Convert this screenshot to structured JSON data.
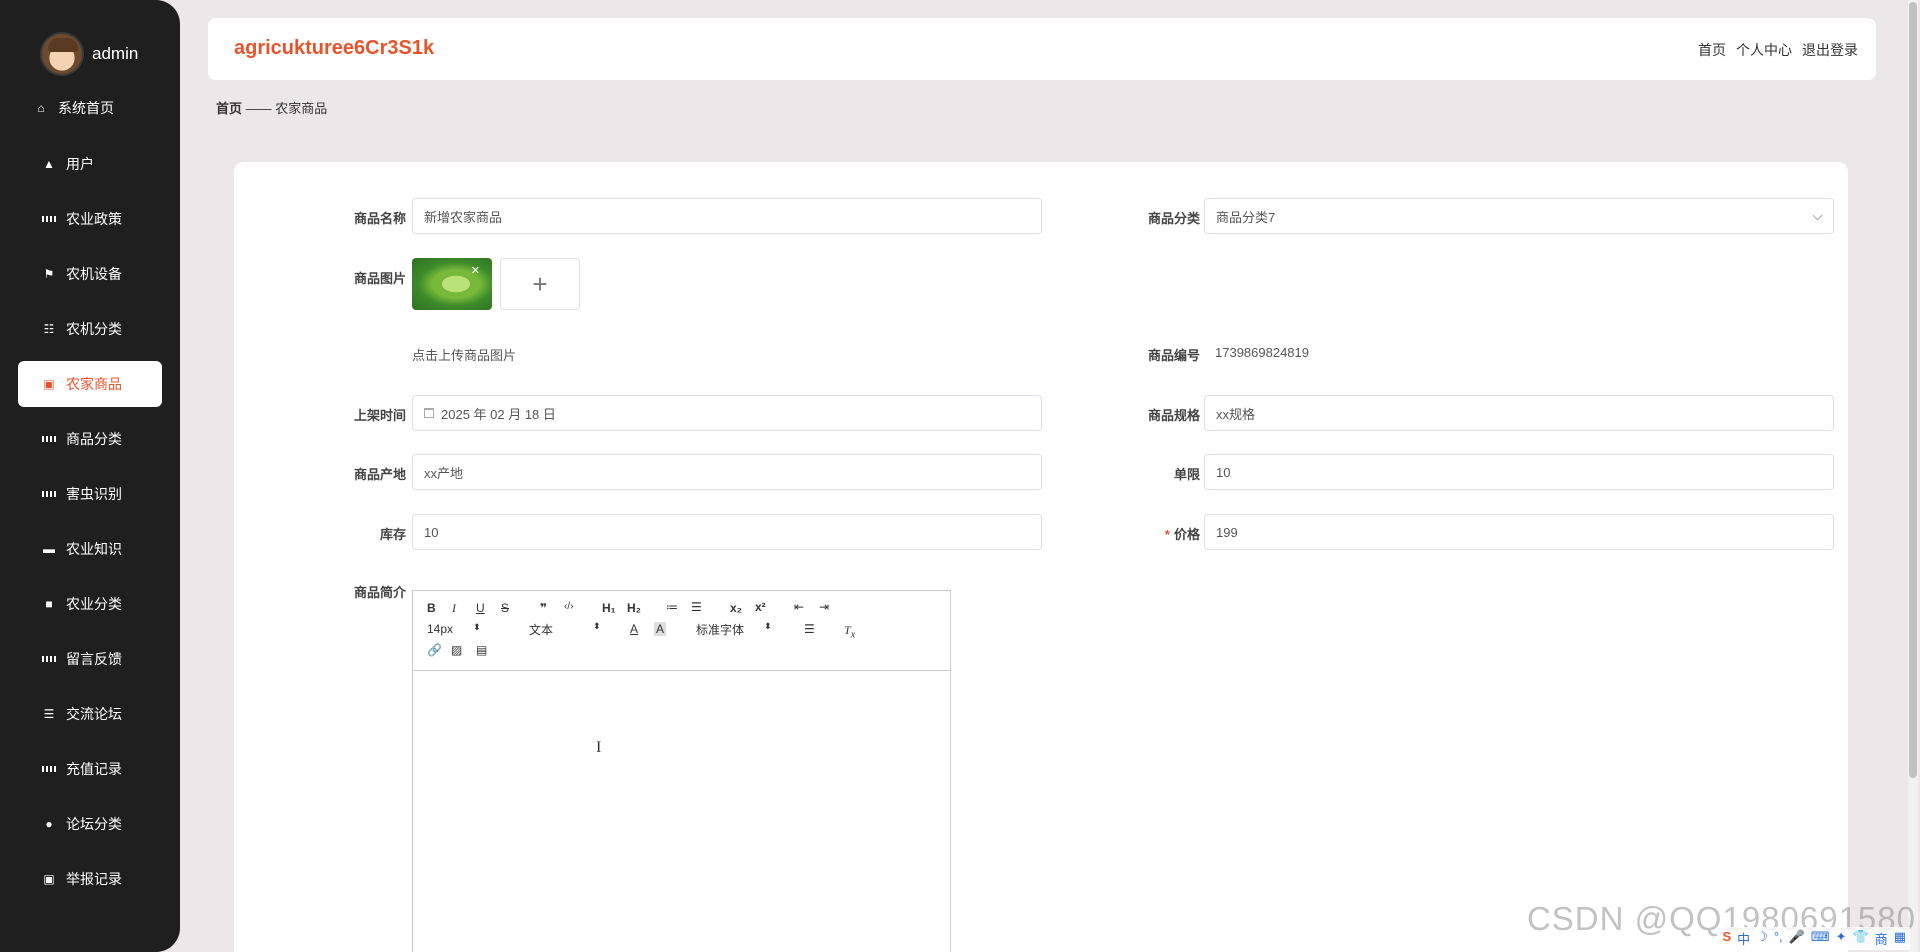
{
  "sidebar": {
    "username": "admin",
    "items": [
      {
        "label": "系统首页",
        "icon": "home-icon"
      },
      {
        "label": "用户",
        "icon": "user-thumb-icon"
      },
      {
        "label": "农业政策",
        "icon": "grid-icon"
      },
      {
        "label": "农机设备",
        "icon": "flag-icon"
      },
      {
        "label": "农机分类",
        "icon": "list-icon"
      },
      {
        "label": "农家商品",
        "icon": "clipboard-icon",
        "active": true
      },
      {
        "label": "商品分类",
        "icon": "grid-icon"
      },
      {
        "label": "害虫识别",
        "icon": "grid-icon"
      },
      {
        "label": "农业知识",
        "icon": "chat-icon"
      },
      {
        "label": "农业分类",
        "icon": "briefcase-icon"
      },
      {
        "label": "留言反馈",
        "icon": "grid-icon"
      },
      {
        "label": "交流论坛",
        "icon": "sliders-icon"
      },
      {
        "label": "充值记录",
        "icon": "grid-icon"
      },
      {
        "label": "论坛分类",
        "icon": "person-icon"
      },
      {
        "label": "举报记录",
        "icon": "clipboard-icon"
      }
    ]
  },
  "header": {
    "title": "agricukturee6Cr3S1k",
    "links": [
      "首页",
      "个人中心",
      "退出登录"
    ]
  },
  "breadcrumb": {
    "home": "首页",
    "separator": "——",
    "current": "农家商品"
  },
  "form": {
    "name": {
      "label": "商品名称",
      "value": "新增农家商品"
    },
    "category": {
      "label": "商品分类",
      "value": "商品分类7"
    },
    "image": {
      "label": "商品图片",
      "hint": "点击上传商品图片",
      "add_symbol": "+",
      "remove_symbol": "✕"
    },
    "code": {
      "label": "商品编号",
      "value": "1739869824819"
    },
    "listing_time": {
      "label": "上架时间",
      "value": "2025 年 02 月 18 日"
    },
    "spec": {
      "label": "商品规格",
      "value": "xx规格"
    },
    "origin": {
      "label": "商品产地",
      "value": "xx产地"
    },
    "limit": {
      "label": "单限",
      "value": "10"
    },
    "stock": {
      "label": "库存",
      "value": "10"
    },
    "price": {
      "label": "价格",
      "value": "199",
      "required_mark": "*"
    },
    "intro": {
      "label": "商品简介"
    }
  },
  "editor": {
    "buttons_row1": [
      "B",
      "I",
      "U",
      "S",
      "❞",
      "‹/›",
      "H₁",
      "H₂",
      "≔",
      "☰",
      "x₂",
      "x²",
      "⇤",
      "⇥"
    ],
    "font_size": "14px",
    "text_type": "文本",
    "font_family": "标准字体"
  },
  "watermark": "CSDN @QQ1980691580"
}
